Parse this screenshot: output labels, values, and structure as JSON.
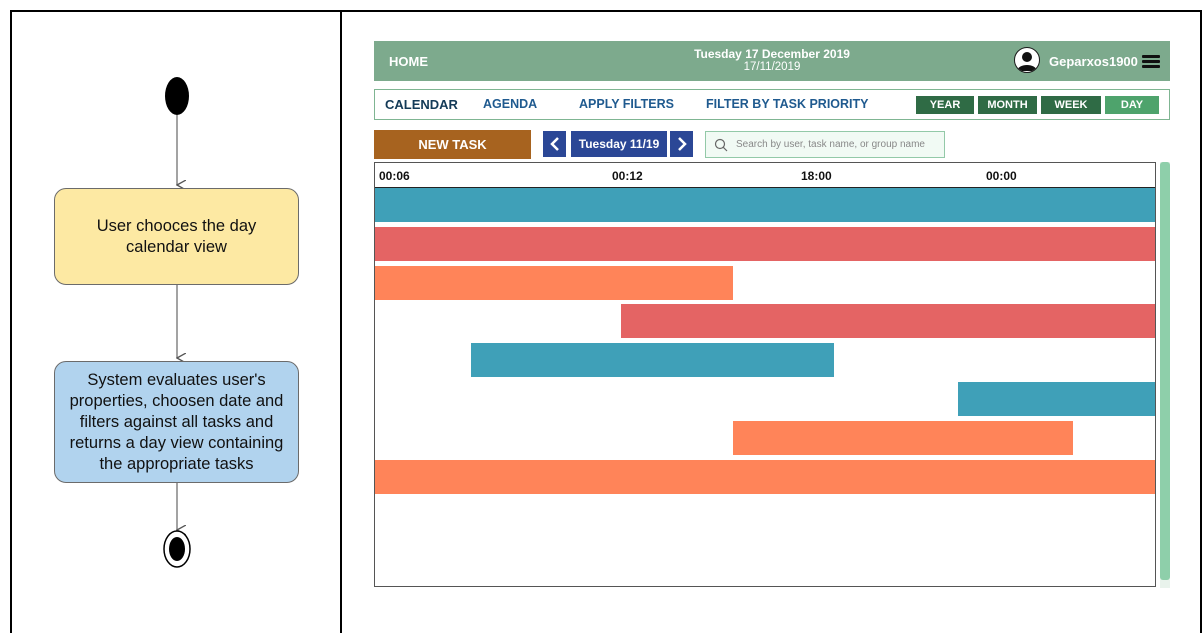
{
  "diagram": {
    "activity_1": "User chooces the day calendar view",
    "activity_2": "System evaluates user's properties, choosen date and filters against all tasks and returns a day view containing the appropriate tasks"
  },
  "app": {
    "topbar": {
      "home": "HOME",
      "date_main": "Tuesday 17 December 2019",
      "date_sub": "17/11/2019",
      "username": "Geparxos1900"
    },
    "nav": {
      "tabs": [
        "CALENDAR",
        "AGENDA",
        "APPLY FILTERS",
        "FILTER BY TASK PRIORITY"
      ],
      "views": [
        "YEAR",
        "MONTH",
        "WEEK",
        "DAY"
      ],
      "active_view": "DAY"
    },
    "toolbar": {
      "new_task": "NEW TASK",
      "prev_icon": "chevron-left-icon",
      "next_icon": "chevron-right-icon",
      "current_date": "Tuesday 11/19",
      "search_placeholder": "Search by user, task name, or group name"
    },
    "timeline": {
      "ticks": [
        "00:06",
        "00:12",
        "18:00",
        "00:00"
      ]
    },
    "task_rows": [
      {
        "color": "#3fa0b8",
        "start": 0.0,
        "end": 1.0
      },
      {
        "color": "#e46464",
        "start": 0.0,
        "end": 1.0
      },
      {
        "color": "#ff8459",
        "start": 0.0,
        "end": 0.4585
      },
      {
        "color": "#e46464",
        "start": 0.315,
        "end": 1.0
      },
      {
        "color": "#3fa0b8",
        "start": 0.1235,
        "end": 0.589
      },
      {
        "color": "#3fa0b8",
        "start": 0.747,
        "end": 1.0
      },
      {
        "color": "#ff8459",
        "start": 0.4585,
        "end": 0.894
      },
      {
        "color": "#ff8459",
        "start": 0.0,
        "end": 1.0
      }
    ],
    "colors": {
      "header": "#7daa8d",
      "accent_green": "#2f6b45",
      "active_view": "#4ea36c",
      "new_task": "#a7631f",
      "date_nav": "#2b4796"
    }
  }
}
